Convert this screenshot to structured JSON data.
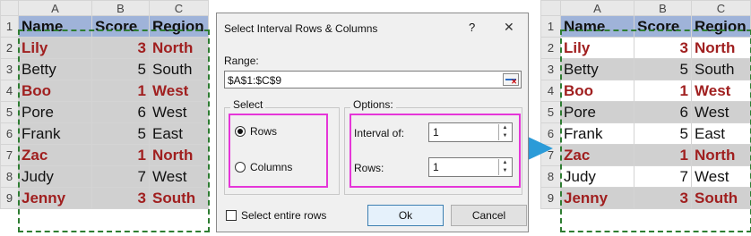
{
  "left_sheet": {
    "col_headers": [
      "A",
      "B",
      "C"
    ],
    "rows": [
      {
        "n": "1",
        "a": "Name",
        "b": "Score",
        "c": "Region"
      },
      {
        "n": "2",
        "a": "Lily",
        "b": "3",
        "c": "North"
      },
      {
        "n": "3",
        "a": "Betty",
        "b": "5",
        "c": "South"
      },
      {
        "n": "4",
        "a": "Boo",
        "b": "1",
        "c": "West"
      },
      {
        "n": "5",
        "a": "Pore",
        "b": "6",
        "c": "West"
      },
      {
        "n": "6",
        "a": "Frank",
        "b": "5",
        "c": "East"
      },
      {
        "n": "7",
        "a": "Zac",
        "b": "1",
        "c": "North"
      },
      {
        "n": "8",
        "a": "Judy",
        "b": "7",
        "c": "West"
      },
      {
        "n": "9",
        "a": "Jenny",
        "b": "3",
        "c": "South"
      }
    ]
  },
  "right_sheet": {
    "col_headers": [
      "A",
      "B",
      "C"
    ],
    "rows": [
      {
        "n": "1",
        "a": "Name",
        "b": "Score",
        "c": "Region"
      },
      {
        "n": "2",
        "a": "Lily",
        "b": "3",
        "c": "North"
      },
      {
        "n": "3",
        "a": "Betty",
        "b": "5",
        "c": "South"
      },
      {
        "n": "4",
        "a": "Boo",
        "b": "1",
        "c": "West"
      },
      {
        "n": "5",
        "a": "Pore",
        "b": "6",
        "c": "West"
      },
      {
        "n": "6",
        "a": "Frank",
        "b": "5",
        "c": "East"
      },
      {
        "n": "7",
        "a": "Zac",
        "b": "1",
        "c": "North"
      },
      {
        "n": "8",
        "a": "Judy",
        "b": "7",
        "c": "West"
      },
      {
        "n": "9",
        "a": "Jenny",
        "b": "3",
        "c": "South"
      }
    ]
  },
  "dialog": {
    "title": "Select Interval Rows & Columns",
    "help": "?",
    "close": "✕",
    "range_label": "Range:",
    "range_value": "$A$1:$C$9",
    "select_label": "Select",
    "rows_option": "Rows",
    "columns_option": "Columns",
    "options_label": "Options:",
    "interval_label": "Interval of:",
    "interval_value": "1",
    "rows_label": "Rows:",
    "rows_value": "1",
    "select_entire_rows": "Select entire rows",
    "ok": "Ok",
    "cancel": "Cancel"
  },
  "colors": {
    "header_fill": "#9fb3d9",
    "selected_fill": "#d0d0d0",
    "red_text": "#a01f1f",
    "highlight": "#e536d8",
    "arrow": "#2b9bd8"
  }
}
